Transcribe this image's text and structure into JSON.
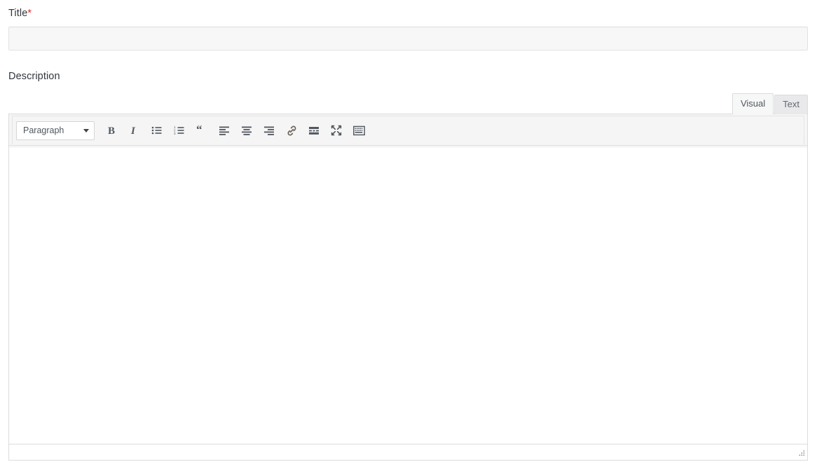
{
  "form": {
    "title_field": {
      "label": "Title",
      "required_marker": "*",
      "value": "",
      "placeholder": ""
    },
    "description_field": {
      "label": "Description"
    }
  },
  "editor": {
    "tabs": [
      {
        "label": "Visual",
        "name": "visual",
        "active": true
      },
      {
        "label": "Text",
        "name": "text",
        "active": false
      }
    ],
    "toolbar": {
      "format_select": {
        "value": "Paragraph",
        "caret_icon": "chevron-down-icon"
      },
      "buttons": [
        {
          "name": "bold-button",
          "icon": "bold-icon",
          "title": "Bold"
        },
        {
          "name": "italic-button",
          "icon": "italic-icon",
          "title": "Italic"
        },
        {
          "name": "bullet-list-button",
          "icon": "unordered-list-icon",
          "title": "Bulleted list"
        },
        {
          "name": "numbered-list-button",
          "icon": "ordered-list-icon",
          "title": "Numbered list"
        },
        {
          "name": "blockquote-button",
          "icon": "blockquote-icon",
          "title": "Blockquote"
        },
        {
          "name": "align-left-button",
          "icon": "align-left-icon",
          "title": "Align left"
        },
        {
          "name": "align-center-button",
          "icon": "align-center-icon",
          "title": "Align center"
        },
        {
          "name": "align-right-button",
          "icon": "align-right-icon",
          "title": "Align right"
        },
        {
          "name": "insert-link-button",
          "icon": "link-icon",
          "title": "Insert/edit link"
        },
        {
          "name": "read-more-button",
          "icon": "insert-more-icon",
          "title": "Insert Read More tag"
        },
        {
          "name": "fullscreen-button",
          "icon": "fullscreen-icon",
          "title": "Distraction-free writing mode"
        },
        {
          "name": "toolbar-toggle-button",
          "icon": "keyboard-icon",
          "title": "Toolbar Toggle"
        }
      ]
    },
    "content": {
      "value": ""
    },
    "statusbar": {
      "resize_handle": "resize-grip-icon"
    }
  },
  "colors": {
    "label_text": "#32373c",
    "required_star": "#e02b27",
    "input_bg": "#f7f7f7",
    "input_border": "#e2e2e2",
    "toolbar_bg": "#f5f5f5",
    "icon": "#50575e",
    "border": "#dcdcde",
    "tab_inactive_bg": "#e9e9eb",
    "tab_active_bg": "#f6f7f7"
  }
}
